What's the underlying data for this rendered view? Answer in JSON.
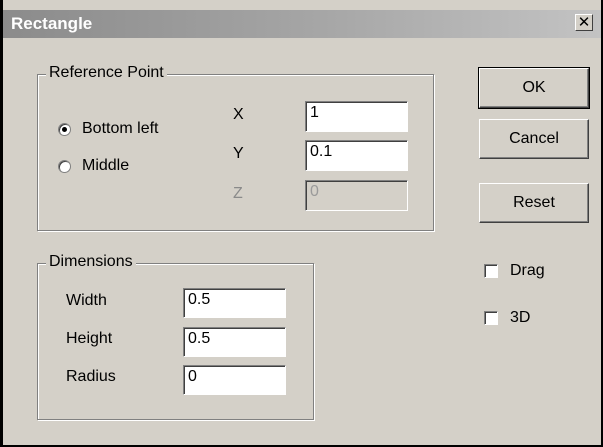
{
  "window": {
    "title": "Rectangle",
    "close_glyph": "✕"
  },
  "reference_point": {
    "group_label": "Reference Point",
    "options": [
      {
        "label": "Bottom left",
        "selected": true
      },
      {
        "label": "Middle",
        "selected": false
      }
    ],
    "x": {
      "label": "X",
      "value": "1"
    },
    "y": {
      "label": "Y",
      "value": "0.1"
    },
    "z": {
      "label": "Z",
      "value": "0",
      "disabled": true
    }
  },
  "dimensions": {
    "group_label": "Dimensions",
    "width": {
      "label": "Width",
      "value": "0.5"
    },
    "height": {
      "label": "Height",
      "value": "0.5"
    },
    "radius": {
      "label": "Radius",
      "value": "0"
    }
  },
  "buttons": {
    "ok": "OK",
    "cancel": "Cancel",
    "reset": "Reset"
  },
  "checkboxes": {
    "drag": {
      "label": "Drag",
      "checked": false
    },
    "three_d": {
      "label": "3D",
      "checked": false
    }
  }
}
